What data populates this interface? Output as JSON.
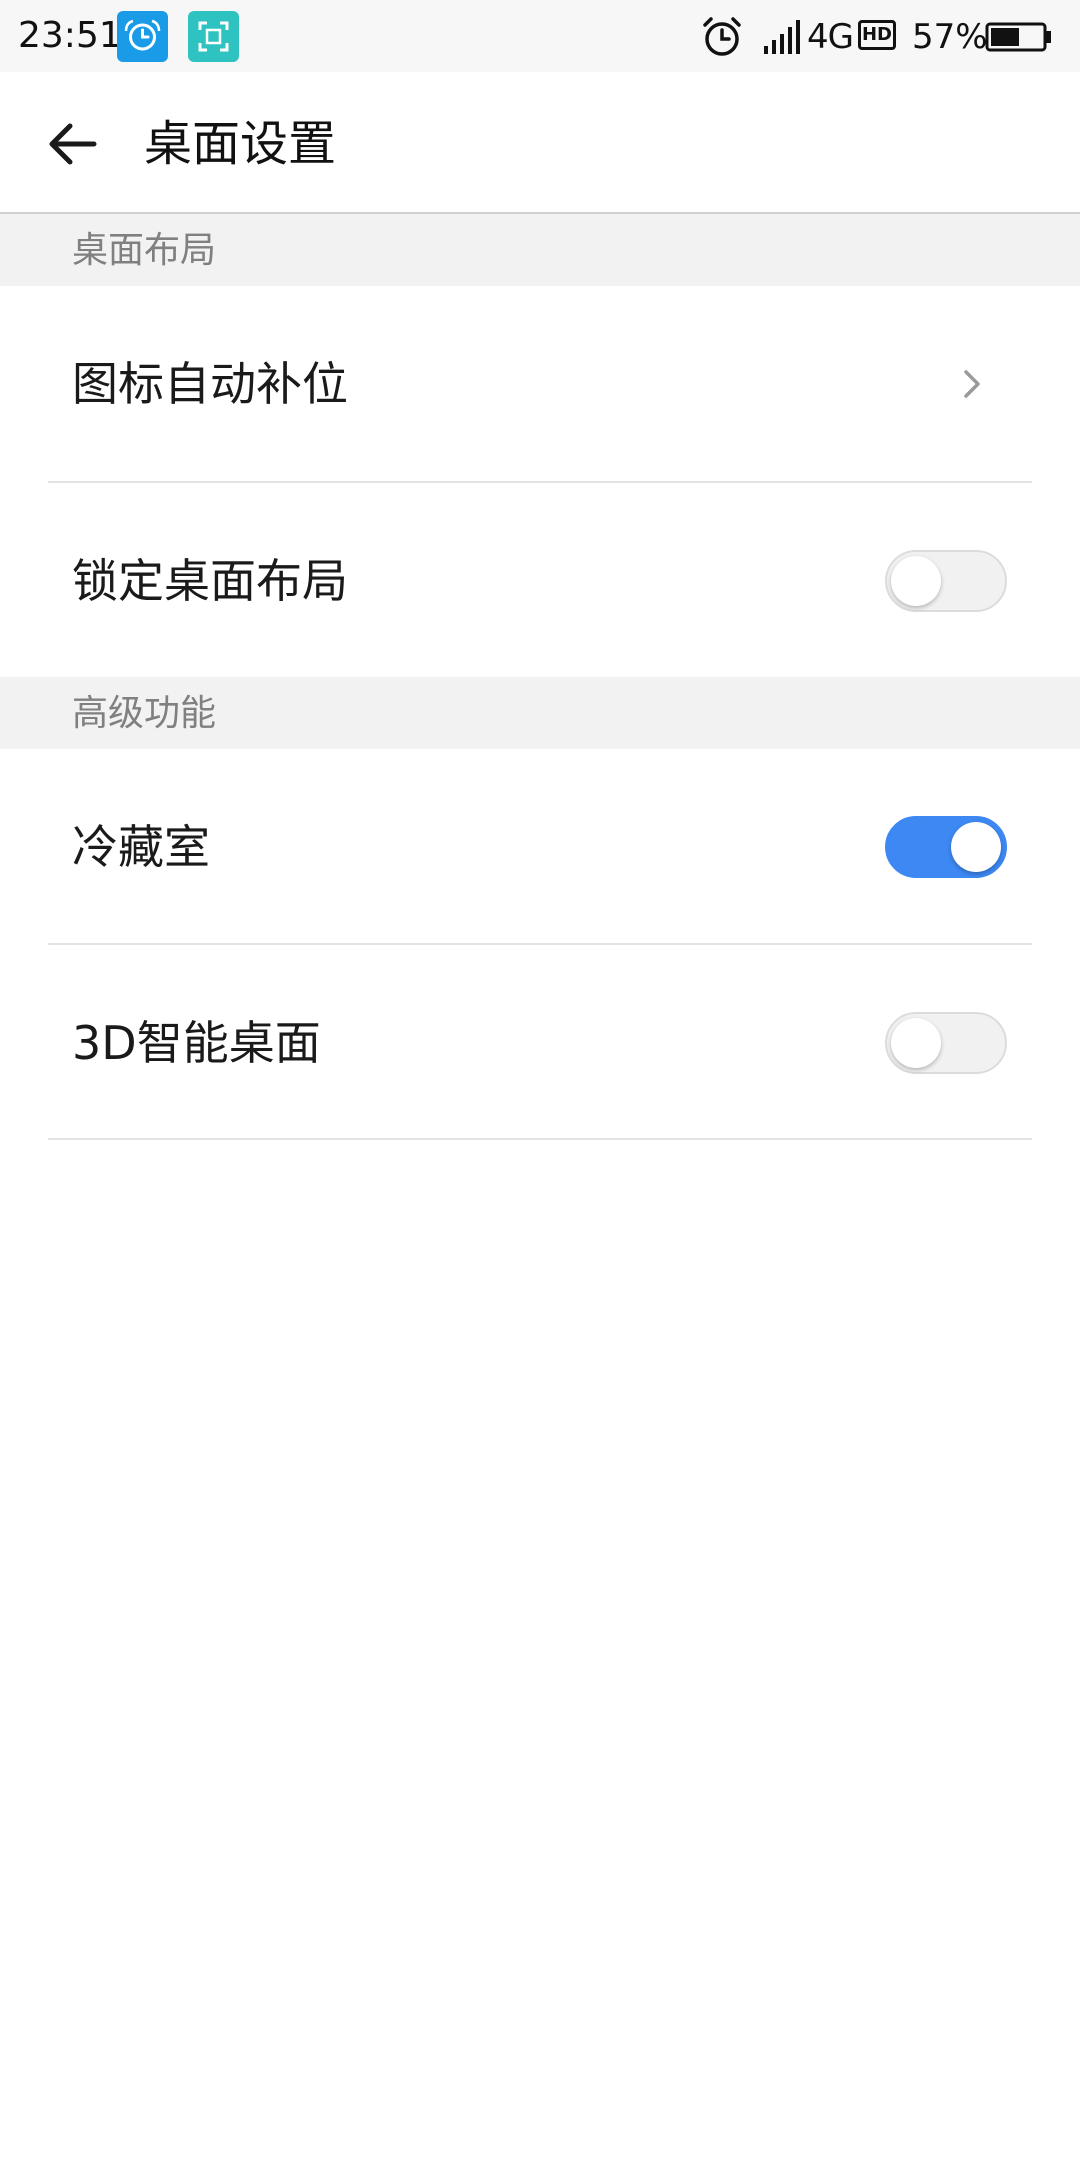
{
  "status_bar": {
    "time": "23:51",
    "notification_icons": [
      "clock-app-icon",
      "screenshot-app-icon"
    ],
    "alarm_icon": "alarm-clock-icon",
    "signal_icon": "signal-bars-icon",
    "network": "4G",
    "hd_badge": "HD",
    "battery_percent": "57%",
    "battery_level": 0.57
  },
  "app_bar": {
    "back_icon": "arrow-left-icon",
    "title": "桌面设置"
  },
  "sections": [
    {
      "header": "桌面布局",
      "items": [
        {
          "label": "图标自动补位",
          "control": "chevron",
          "icon": "chevron-right-icon"
        },
        {
          "label": "锁定桌面布局",
          "control": "toggle",
          "checked": false
        }
      ]
    },
    {
      "header": "高级功能",
      "items": [
        {
          "label": "冷藏室",
          "control": "toggle",
          "checked": true
        },
        {
          "label": "3D智能桌面",
          "control": "toggle",
          "checked": false
        }
      ]
    }
  ],
  "colors": {
    "accent": "#3d88f2",
    "section_header_bg": "#f2f2f2",
    "section_header_text": "#808080",
    "notification_icon_1": "#1a9be8",
    "notification_icon_2": "#2ec3c0"
  }
}
